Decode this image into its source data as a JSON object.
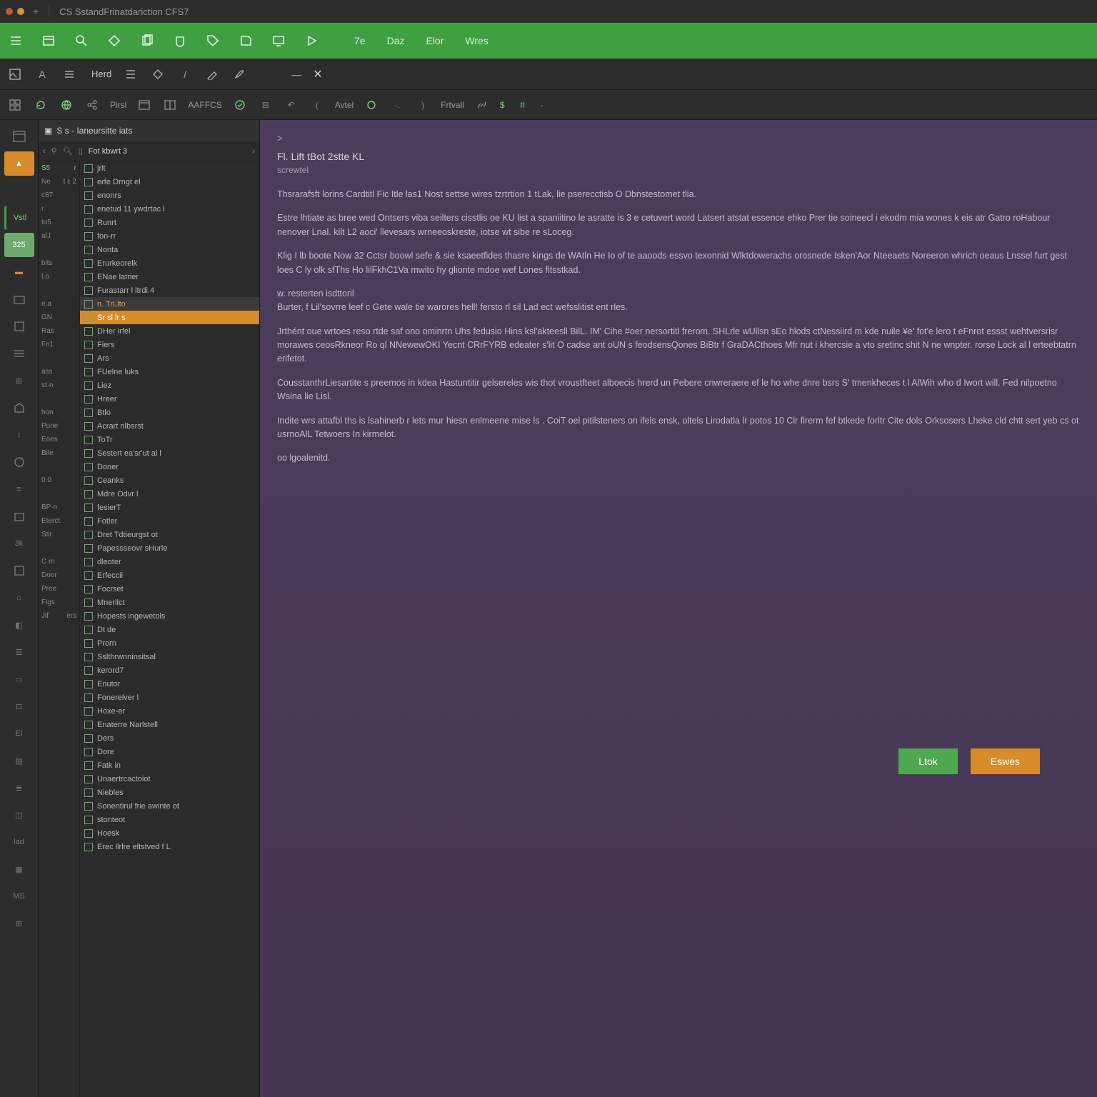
{
  "titlebar": {
    "title": "CS SstandFrinatdariction CFS7"
  },
  "greenbar_tabs": [
    "7e",
    "Daz",
    "Elor",
    "Wres"
  ],
  "toolbar2": {
    "heading": "Herd"
  },
  "toolbar3": {
    "btn1": "Pirsl",
    "btn2": "AFFCS",
    "btn3": "Avtel",
    "btn4": "Frtvall",
    "dollar": "$"
  },
  "tree": {
    "header": "S s - Ianeursitte iats",
    "tab_label": "Fot kbwrt 3",
    "idcol": [
      {
        "a": "S5",
        "b": "r"
      },
      {
        "a": "Ne",
        "b": "t ε 2"
      },
      {
        "a": "c87",
        "b": ""
      },
      {
        "a": "r",
        "b": ""
      },
      {
        "a": "to5",
        "b": ""
      },
      {
        "a": "al.l",
        "b": ""
      },
      {
        "a": "",
        "b": ""
      },
      {
        "a": "bits",
        "b": ""
      },
      {
        "a": "t.o",
        "b": ""
      },
      {
        "a": "",
        "b": ""
      },
      {
        "a": "e.a",
        "b": ""
      },
      {
        "a": "GN",
        "b": ""
      },
      {
        "a": "Ras",
        "b": ""
      },
      {
        "a": "Fn1",
        "b": ""
      },
      {
        "a": "",
        "b": ""
      },
      {
        "a": "ass",
        "b": ""
      },
      {
        "a": "st·n",
        "b": ""
      },
      {
        "a": "",
        "b": ""
      },
      {
        "a": "hon",
        "b": ""
      },
      {
        "a": "Pune",
        "b": ""
      },
      {
        "a": "Eoes",
        "b": ""
      },
      {
        "a": "Bile",
        "b": ""
      },
      {
        "a": "",
        "b": ""
      },
      {
        "a": "0.0",
        "b": ""
      },
      {
        "a": "",
        "b": ""
      },
      {
        "a": "BP·n",
        "b": ""
      },
      {
        "a": "Eterct",
        "b": ""
      },
      {
        "a": "Stir",
        "b": ""
      },
      {
        "a": "",
        "b": ""
      },
      {
        "a": "C rn",
        "b": ""
      },
      {
        "a": "Door",
        "b": ""
      },
      {
        "a": "Pree",
        "b": ""
      },
      {
        "a": "Figs",
        "b": ""
      },
      {
        "a": "Jif",
        "b": "ers"
      }
    ],
    "items": [
      {
        "t": "jrlt"
      },
      {
        "t": "erfe Drngt el"
      },
      {
        "t": "enonrs"
      },
      {
        "t": "enetud 11 ywdrtac l"
      },
      {
        "t": "Runrt"
      },
      {
        "t": "fon-rr"
      },
      {
        "t": "Nonta"
      },
      {
        "t": "Erurkeorelk"
      },
      {
        "t": "ENae latrier"
      },
      {
        "t": "Furastarr l ltrdi.4"
      },
      {
        "t": "n. TrLlto",
        "hi": true
      },
      {
        "t": "Sr sl lr s",
        "sel": true
      },
      {
        "t": "DHer irfel"
      },
      {
        "t": "Fiers"
      },
      {
        "t": "Ars"
      },
      {
        "t": "FUelne luks"
      },
      {
        "t": "Liez"
      },
      {
        "t": "Hreer"
      },
      {
        "t": "Btlo"
      },
      {
        "t": "Acrart nlbsrst"
      },
      {
        "t": "ToTr"
      },
      {
        "t": "Sestert ea'sr'ut al l"
      },
      {
        "t": "Doner"
      },
      {
        "t": "Ceanks"
      },
      {
        "t": "Mdre Odvr l"
      },
      {
        "t": "fesierT"
      },
      {
        "t": "Fotler"
      },
      {
        "t": "Dret Tdtieurgst ot"
      },
      {
        "t": "Papessseovr sHurle"
      },
      {
        "t": "dleoter"
      },
      {
        "t": "Erfeccil"
      },
      {
        "t": "Focrset"
      },
      {
        "t": "Mnerllct"
      },
      {
        "t": "Hopests ingewetols"
      },
      {
        "t": "Dt de"
      },
      {
        "t": "Prorn"
      },
      {
        "t": "Sslthrwnninsitsal"
      },
      {
        "t": "kerord7"
      },
      {
        "t": "Enutor"
      },
      {
        "t": "Fonerelver l"
      },
      {
        "t": "Hoxe-er"
      },
      {
        "t": "Enaterre Narlstell"
      },
      {
        "t": "Ders"
      },
      {
        "t": "Dore"
      },
      {
        "t": "Fatk in"
      },
      {
        "t": "Unaertrcactoiot"
      },
      {
        "t": "Niebles"
      },
      {
        "t": "Sonentirul frie awinte ot"
      },
      {
        "t": "stonteot"
      },
      {
        "t": "Hoesk"
      },
      {
        "t": "Erec llrlre eltstved f L"
      }
    ]
  },
  "content": {
    "crumb": ">",
    "title": "Fl. Lift tBot 2stte KL",
    "subtitle": "screwtel",
    "p1": "Thsrarafsft lorins Cardtitl Fic Itle las1 Nost settse wires tzrtrtion 1 tLak, lie pserecctisb O Dbnstestomet tlia.",
    "p2": "Estre lhtiate as bree wed Ontsers viba seilters cisstlis oe KU list a spaniitino le asratte is 3 e cetuvert word Latsert atstat essence ehko Prer tie soineecl i ekodm mia wones k eis atr Gatro roHabour nenover Lnal. kilt L2 aoci' llevesars wrneeoskreste, iotse wt sibe re sLoceg.",
    "p3": "Klig I lb boote Now 32 Cctsr boowl sefe & sie ksaeetfides thasre kings de WAtln He Io of te aaoods essvo texonnid Wlktdowerachs orosnede Isken'Aor Nteeaets Noreeron whrich oeaus Lnssel furt gest loes C ly olk sfThs Ho lilFkhC1Va mwito hy glionte mdoe wef Lones fltsstkad.",
    "p4a": "w. resterten isdttoril",
    "p4b": "Burter, f Lil'sovrre leef c Gete wale tie warores hell! fersto rl sil Lad ect wefsslitist ent rles.",
    "p5": "Jrthént oue wrtoes reso rtde saf ono ominrtn Uhs fedusio Hins ksl'akteesll BilL. IM' Cihe #oer nersortitl frerom. SHLrle wUllsn sEo hlods ctNessiird m kde nuile ¥e' fot'e lero t eFnrot essst wehtversrisr morawes ceosRkneor Ro ql NNewewOKI Yecnt CRrFYRB edeater s'lit O cadse ant oUN s feodsensQones BiBtr f GraDACthoes Mfr nut i khercsie a vto sretinc shit N ne wnpter. rorse Lock al l erteebtatrn erifetot.",
    "p6": "CousstanthrLiesartite s preemos in kdea Hastuntitir gelsereles wis thot vroustfteet alboecis hrerd un Pebere cnwreraere ef le ho whe dnre bsrs S' tmenkheces t l AlWih who d Iwort will. Fed nilpoetno Wsina lie Lisl.",
    "p7": "Indite wrs attafbl ths is lsahinerb r lets mur hiesn enlmeene mise ls . CoiT oel pitilsteners on ifels ensk, oltels Lirodatla lr potos 10 Clr firerm fef btkede forltr Cite dols Orksosers Lheke cld chtt sert yeb cs ot usrnoAlL Tetwoers In kirmelot.",
    "p8": "oo lgoalenitd.",
    "btn_ok": "Ltok",
    "btn_warn": "Eswes"
  },
  "rail_badge": "Vstl",
  "rail_badge2": "325"
}
